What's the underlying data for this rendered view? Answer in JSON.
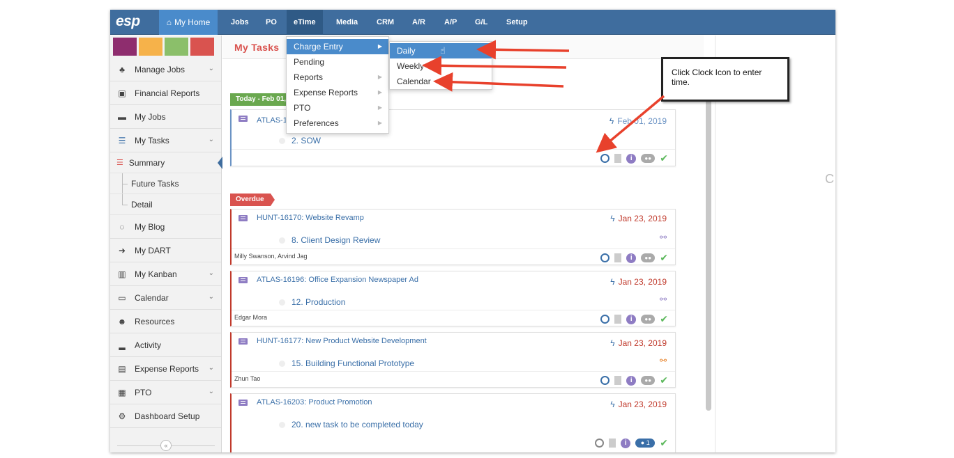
{
  "app": {
    "logo": "esp",
    "home_label": "My Home",
    "nav": [
      "Jobs",
      "PO",
      "eTime",
      "Media",
      "CRM",
      "A/R",
      "A/P",
      "G/L",
      "Setup"
    ],
    "colors": {
      "nav_bg": "#3f6d9e",
      "home_bg": "#4a8bcb",
      "accent_red": "#d9534f"
    }
  },
  "swatches": [
    "#8e2d6e",
    "#f6b24a",
    "#8bbf6a",
    "#d9534f"
  ],
  "sidebar": {
    "items": [
      {
        "label": "Manage Jobs",
        "icon": "sitemap-icon",
        "glyph": "♣",
        "has_chevron": true
      },
      {
        "label": "Financial Reports",
        "icon": "chart-file-icon",
        "glyph": "▣",
        "has_chevron": false
      },
      {
        "label": "My Jobs",
        "icon": "folder-icon",
        "glyph": "▬",
        "has_chevron": false
      },
      {
        "label": "My Tasks",
        "icon": "tasks-icon",
        "glyph": "☰",
        "has_chevron": true
      }
    ],
    "sub_items": [
      "Summary",
      "Future Tasks",
      "Detail"
    ],
    "items_after": [
      {
        "label": "My Blog",
        "icon": "comments-icon",
        "glyph": "◌",
        "has_chevron": false
      },
      {
        "label": "My DART",
        "icon": "arrow-circle-icon",
        "glyph": "➜",
        "has_chevron": false
      },
      {
        "label": "My Kanban",
        "icon": "map-icon",
        "glyph": "▥",
        "has_chevron": true
      },
      {
        "label": "Calendar",
        "icon": "calendar-icon",
        "glyph": "▭",
        "has_chevron": true
      },
      {
        "label": "Resources",
        "icon": "users-icon",
        "glyph": "☻",
        "has_chevron": false
      },
      {
        "label": "Activity",
        "icon": "signal-icon",
        "glyph": "▂",
        "has_chevron": false
      },
      {
        "label": "Expense Reports",
        "icon": "money-icon",
        "glyph": "▤",
        "has_chevron": true
      },
      {
        "label": "PTO",
        "icon": "calendar-grid-icon",
        "glyph": "▦",
        "has_chevron": true
      },
      {
        "label": "Dashboard Setup",
        "icon": "cogs-icon",
        "glyph": "⚙",
        "has_chevron": false
      }
    ]
  },
  "main": {
    "title": "My Tasks",
    "today_label": "Today - Feb 01,",
    "overdue_label": "Overdue",
    "today_card": {
      "job": "ATLAS-16",
      "task": "2. SOW",
      "due": "Feb 01, 2019"
    },
    "overdue_cards": [
      {
        "job": "HUNT-16170: Website Revamp",
        "task": "8. Client Design Review",
        "due": "Jan 23, 2019",
        "assignees": "Milly Swanson, Arvind Jag",
        "link_color": "#8e7cc3"
      },
      {
        "job": "ATLAS-16196: Office Expansion Newspaper Ad",
        "task": "12. Production",
        "due": "Jan 23, 2019",
        "assignees": "Edgar Mora",
        "link_color": "#8e7cc3"
      },
      {
        "job": "HUNT-16177: New Product Website Development",
        "task": "15. Building Functional Prototype",
        "due": "Jan 23, 2019",
        "assignees": "Zhun Tao",
        "link_color": "#e67e22"
      },
      {
        "job": "ATLAS-16203: Product Promotion",
        "task": "20. new task to be completed today",
        "due": "Jan 23, 2019",
        "assignees": "",
        "comment_count": "1"
      }
    ]
  },
  "etime_menu": {
    "items": [
      "Charge Entry",
      "Pending",
      "Reports",
      "Expense Reports",
      "PTO",
      "Preferences"
    ],
    "submenu": [
      "Daily",
      "Weekly",
      "Calendar"
    ]
  },
  "callout": {
    "text": "Click Clock Icon to enter time."
  },
  "right_glyph": "C"
}
